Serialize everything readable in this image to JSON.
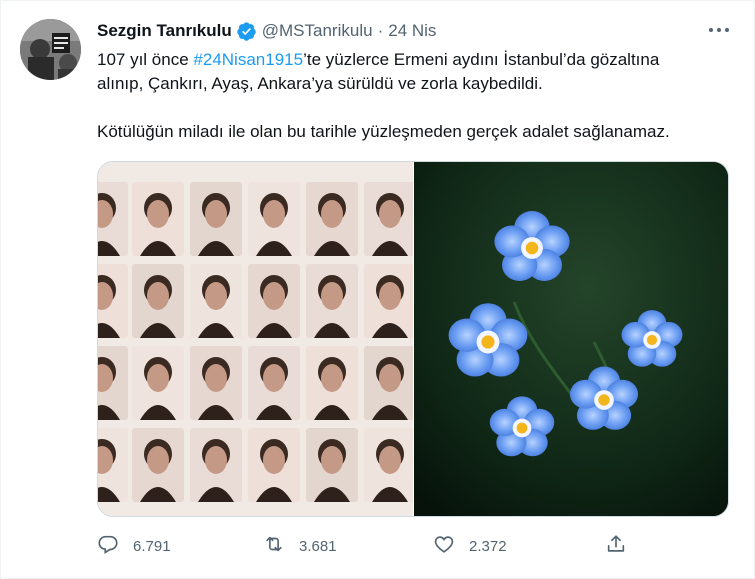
{
  "tweet": {
    "author_name": "Sezgin Tanrıkulu",
    "handle": "@MSTanrikulu",
    "separator": "·",
    "date": "24 Nis",
    "text_line1_before": "107 yıl önce ",
    "hashtag": "#24Nisan1915",
    "text_line1_after": "’te yüzlerce Ermeni aydını İstanbul’da gözaltına",
    "text_line2": "alınıp, Çankırı, Ayaş, Ankara’ya sürüldü ve zorla kaybedildi.",
    "text_line3": "Kötülüğün miladı ile olan bu tarihle yüzleşmeden gerçek adalet sağlanamaz."
  },
  "stats": {
    "replies": "6.791",
    "retweets": "3.681",
    "likes": "2.372"
  },
  "icons": {
    "verified": "verified-badge-icon",
    "more": "more-options-icon",
    "reply": "reply-icon",
    "retweet": "retweet-icon",
    "like": "heart-icon",
    "share": "share-icon"
  },
  "colors": {
    "accent": "#1d9bf0",
    "secondary_text": "#536471",
    "primary_text": "#0f1419"
  }
}
